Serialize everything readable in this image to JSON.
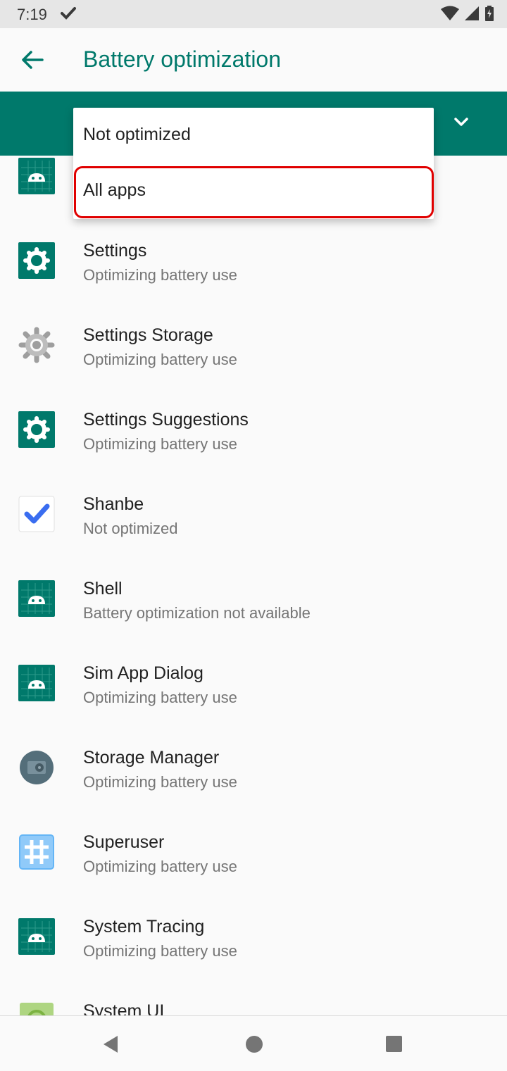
{
  "status_bar": {
    "time": "7:19"
  },
  "app_bar": {
    "title": "Battery optimization"
  },
  "dropdown": {
    "options": [
      {
        "label": "Not optimized"
      },
      {
        "label": "All apps"
      }
    ],
    "highlighted_index": 1
  },
  "apps": [
    {
      "title": "",
      "subtitle": "",
      "icon": "android-icon"
    },
    {
      "title": "Settings",
      "subtitle": "Optimizing battery use",
      "icon": "settings-gear-icon"
    },
    {
      "title": "Settings Storage",
      "subtitle": "Optimizing battery use",
      "icon": "gray-gear-icon"
    },
    {
      "title": "Settings Suggestions",
      "subtitle": "Optimizing battery use",
      "icon": "settings-gear-icon"
    },
    {
      "title": "Shanbe",
      "subtitle": "Not optimized",
      "icon": "checkmark-icon"
    },
    {
      "title": "Shell",
      "subtitle": "Battery optimization not available",
      "icon": "android-icon"
    },
    {
      "title": "Sim App Dialog",
      "subtitle": "Optimizing battery use",
      "icon": "android-icon"
    },
    {
      "title": "Storage Manager",
      "subtitle": "Optimizing battery use",
      "icon": "storage-manager-icon"
    },
    {
      "title": "Superuser",
      "subtitle": "Optimizing battery use",
      "icon": "hash-icon"
    },
    {
      "title": "System Tracing",
      "subtitle": "Optimizing battery use",
      "icon": "android-icon"
    },
    {
      "title": "System UI",
      "subtitle": "",
      "icon": "system-ui-icon"
    }
  ],
  "colors": {
    "accent": "#00796b",
    "highlight": "#e00000"
  }
}
